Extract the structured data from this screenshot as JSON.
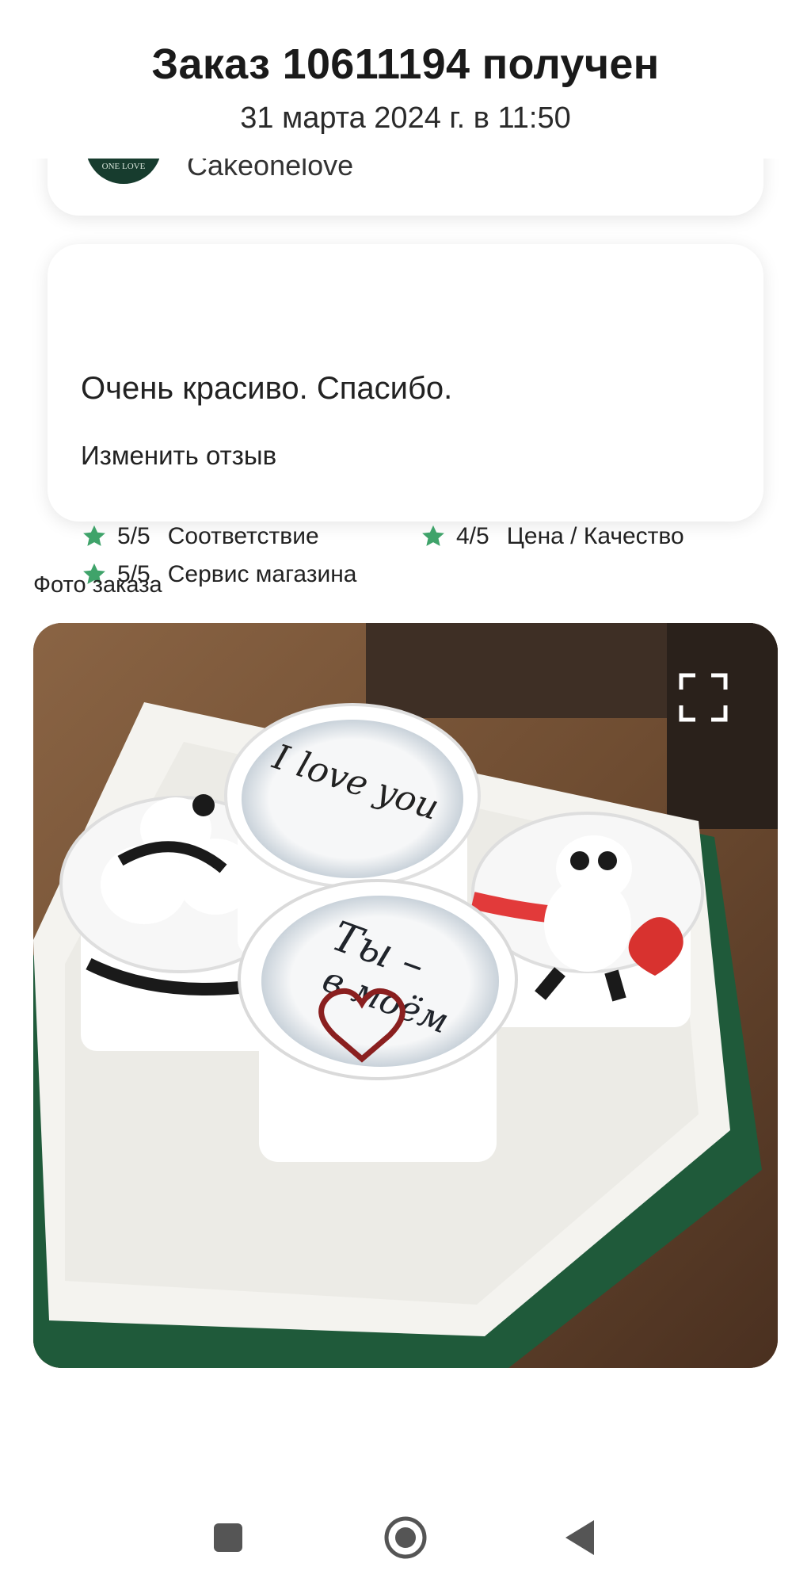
{
  "header": {
    "title": "Заказ 10611194 получен",
    "subtitle": "31 марта 2024 г. в 11:50"
  },
  "shop": {
    "name": "Cakeonelove",
    "logo_text": "ONE LOVE"
  },
  "review": {
    "ratings": [
      {
        "score": "5/5",
        "label": "Соответствие",
        "value": 5,
        "max": 5
      },
      {
        "score": "4/5",
        "label": "Цена / Качество",
        "value": 4,
        "max": 5
      },
      {
        "score": "5/5",
        "label": "Сервис магазина",
        "value": 5,
        "max": 5
      }
    ],
    "text": "Очень красиво. Спасибо.",
    "edit_label": "Изменить отзыв"
  },
  "photo_section": {
    "label": "Фото заказа",
    "photo_texts": {
      "cup_top": "I love you",
      "cup_bottom_line1": "Ты –",
      "cup_bottom_line2": "в моём"
    }
  },
  "colors": {
    "star": "#3fa36a",
    "text": "#1b1b1b",
    "logo_bg": "#173c2e"
  },
  "navbar": {
    "icons": [
      "square-icon",
      "home-circle-icon",
      "back-triangle-icon"
    ]
  }
}
